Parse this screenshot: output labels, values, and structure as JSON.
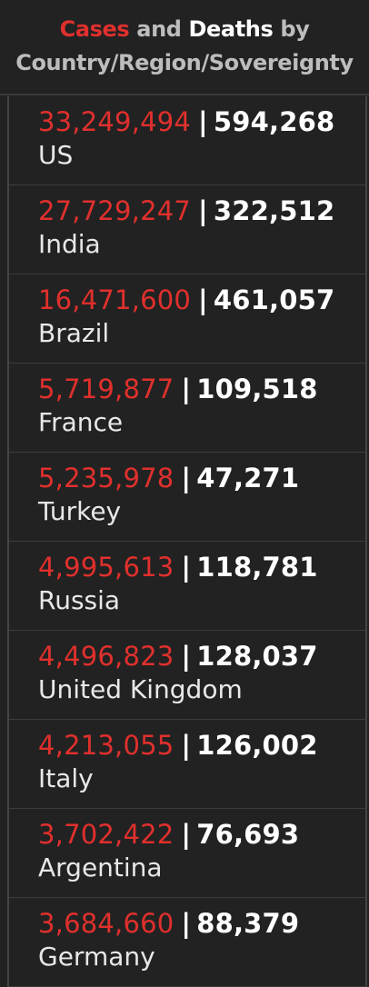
{
  "header": {
    "cases_word": "Cases",
    "and_word": "and",
    "deaths_word": "Deaths",
    "by_word": "by",
    "line2": "Country/Region/Sovereignty"
  },
  "colors": {
    "cases": "#e0302d",
    "deaths": "#ffffff",
    "background": "#222222"
  },
  "rows": [
    {
      "cases": "33,249,494",
      "deaths": "594,268",
      "name": "US"
    },
    {
      "cases": "27,729,247",
      "deaths": "322,512",
      "name": "India"
    },
    {
      "cases": "16,471,600",
      "deaths": "461,057",
      "name": "Brazil"
    },
    {
      "cases": "5,719,877",
      "deaths": "109,518",
      "name": "France"
    },
    {
      "cases": "5,235,978",
      "deaths": "47,271",
      "name": "Turkey"
    },
    {
      "cases": "4,995,613",
      "deaths": "118,781",
      "name": "Russia"
    },
    {
      "cases": "4,496,823",
      "deaths": "128,037",
      "name": "United Kingdom"
    },
    {
      "cases": "4,213,055",
      "deaths": "126,002",
      "name": "Italy"
    },
    {
      "cases": "3,702,422",
      "deaths": "76,693",
      "name": "Argentina"
    },
    {
      "cases": "3,684,660",
      "deaths": "88,379",
      "name": "Germany"
    }
  ]
}
